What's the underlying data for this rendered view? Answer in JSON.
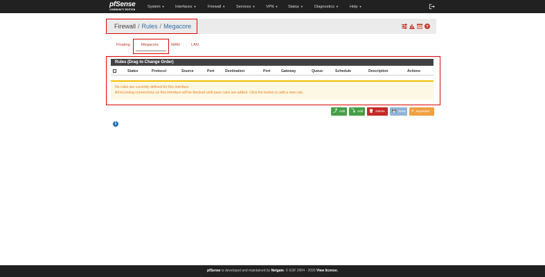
{
  "navbar": {
    "brand": "pfSense",
    "brand_sub": "COMMUNITY EDITION",
    "menu": [
      {
        "label": "System"
      },
      {
        "label": "Interfaces"
      },
      {
        "label": "Firewall"
      },
      {
        "label": "Services"
      },
      {
        "label": "VPN"
      },
      {
        "label": "Status"
      },
      {
        "label": "Diagnostics"
      },
      {
        "label": "Help"
      }
    ],
    "logout_icon": "sign-out-icon"
  },
  "breadcrumb": {
    "items": [
      "Firewall",
      "Rules",
      "Megacore"
    ],
    "separator": "/",
    "icons": [
      "sliders-icon",
      "bar-chart-icon",
      "list-icon",
      "help-icon"
    ]
  },
  "tabs": [
    {
      "label": "Floating",
      "active": false
    },
    {
      "label": "Megacore",
      "active": true
    },
    {
      "label": "WAN",
      "active": false
    },
    {
      "label": "LAN",
      "active": false
    }
  ],
  "rules": {
    "title": "Rules (Drag to Change Order)",
    "columns": [
      "States",
      "Protocol",
      "Source",
      "Port",
      "Destination",
      "Port",
      "Gateway",
      "Queue",
      "Schedule",
      "Description",
      "Actions"
    ],
    "notice_line1": "No rules are currently defined for this interface",
    "notice_line2": "All incoming connections on this interface will be blocked until pass rules are added. Click the button to add a new rule."
  },
  "actions": [
    {
      "label": "Add",
      "glyph": "⤴",
      "color": "#43a047"
    },
    {
      "label": "Add",
      "glyph": "⤵",
      "color": "#43a047"
    },
    {
      "label": "Delete",
      "glyph": "🗑",
      "color": "#c62828"
    },
    {
      "label": "Save",
      "glyph": "💾",
      "color": "#90b4d8"
    },
    {
      "label": "Separator",
      "glyph": "+",
      "color": "#f0a040"
    }
  ],
  "info_icon": "info-circle-icon",
  "footer": {
    "brand": "pfSense",
    "text1": " is developed and maintained by ",
    "company": "Netgate",
    "text2": ". © ESF 2004 - 2020 ",
    "license": "View license."
  }
}
